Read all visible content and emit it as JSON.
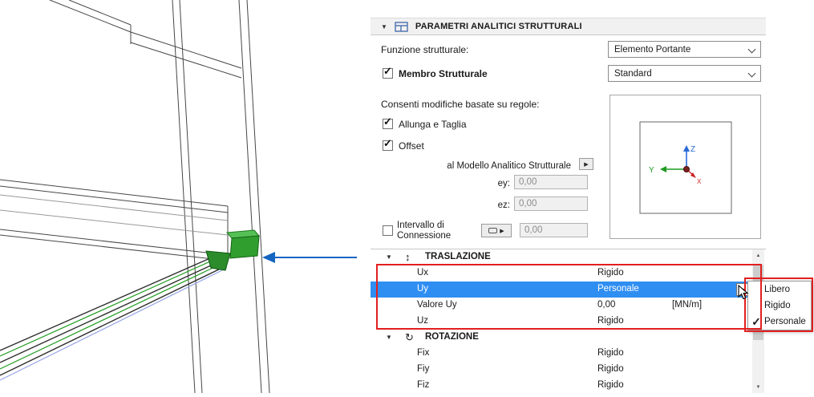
{
  "viewer": {
    "axis_labels": {
      "x": "X",
      "y": "Y",
      "z": "Z"
    }
  },
  "panel": {
    "header": {
      "title": "PARAMETRI ANALITICI STRUTTURALI"
    },
    "funzione": {
      "label": "Funzione strutturale:",
      "value": "Elemento Portante"
    },
    "membro": {
      "label": "Membro Strutturale",
      "checked": true,
      "value": "Standard"
    },
    "regole_label": "Consenti modifiche basate su regole:",
    "allunga": {
      "label": "Allunga e Taglia",
      "checked": true
    },
    "offset": {
      "label": "Offset",
      "checked": true
    },
    "modello": {
      "label": "al Modello Analitico Strutturale"
    },
    "ey": {
      "label": "ey:",
      "value": "0,00"
    },
    "ez": {
      "label": "ez:",
      "value": "0,00"
    },
    "intervallo": {
      "label": "Intervallo di Connessione",
      "checked": false,
      "value": "0,00"
    }
  },
  "table": {
    "sections": [
      {
        "label": "TRASLAZIONE",
        "rows": [
          {
            "name": "Ux",
            "value": "Rigido"
          },
          {
            "name": "Uy",
            "value": "Personale",
            "selected": true
          },
          {
            "name": "Valore Uy",
            "value": "0,00",
            "unit": "[MN/m]"
          },
          {
            "name": "Uz",
            "value": "Rigido"
          }
        ]
      },
      {
        "label": "ROTAZIONE",
        "rows": [
          {
            "name": "Fix",
            "value": "Rigido"
          },
          {
            "name": "Fiy",
            "value": "Rigido"
          },
          {
            "name": "Fiz",
            "value": "Rigido"
          }
        ]
      }
    ]
  },
  "popup": {
    "items": [
      {
        "label": "Libero",
        "checked": false
      },
      {
        "label": "Rigido",
        "checked": false
      },
      {
        "label": "Personale",
        "checked": true
      }
    ]
  },
  "icons": {
    "collapse": "▼",
    "arrow_right": "▶",
    "translation": "↕",
    "rotation": "↻",
    "check": "✓",
    "scroll_up": "▲",
    "scroll_down": "▼"
  },
  "colors": {
    "selection": "#2f8ef2",
    "annotation": "#e21f1f",
    "arrow": "#1565c0",
    "node_green": "#2f9e2f",
    "axis_x": "#cc2222",
    "axis_y": "#1f9b1f",
    "axis_z": "#2b6bd8"
  }
}
